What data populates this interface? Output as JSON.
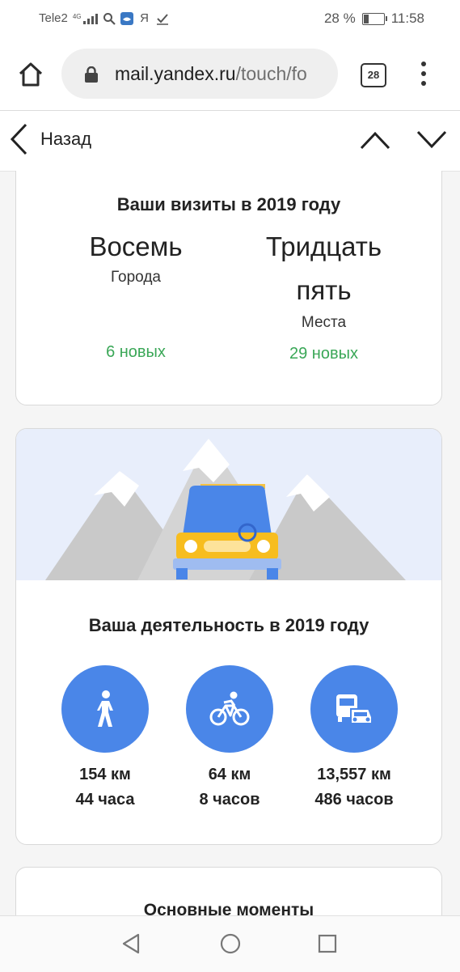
{
  "status_bar": {
    "carrier": "Tele2",
    "network": "4G",
    "app_icons": [
      "search-icon",
      "vk-icon",
      "yandex-icon",
      "check-icon"
    ],
    "yandex_glyph": "Я",
    "battery_percent": "28 %",
    "battery_level": 0.28,
    "time": "11:58"
  },
  "browser": {
    "url_host": "mail.yandex.ru",
    "url_path": "/touch/fo",
    "tab_count": "28"
  },
  "nav": {
    "back_label": "Назад"
  },
  "visits": {
    "title": "Ваши визиты в 2019 году",
    "cities_value": "Восемь",
    "cities_label": "Города",
    "cities_new": "6 новых",
    "places_value": "Тридцать пять",
    "places_label": "Места",
    "places_new": "29 новых",
    "new_color": "#3aa757"
  },
  "activity": {
    "title": "Ваша деятельность в 2019 году",
    "accent_color": "#4a86e8",
    "items": [
      {
        "icon": "walking-icon",
        "distance": "154 км",
        "duration": "44 часа"
      },
      {
        "icon": "cycling-icon",
        "distance": "64 км",
        "duration": "8 часов"
      },
      {
        "icon": "transport-icon",
        "distance": "13,557 км",
        "duration": "486 часов"
      }
    ]
  },
  "highlights": {
    "title": "Основные моменты"
  }
}
